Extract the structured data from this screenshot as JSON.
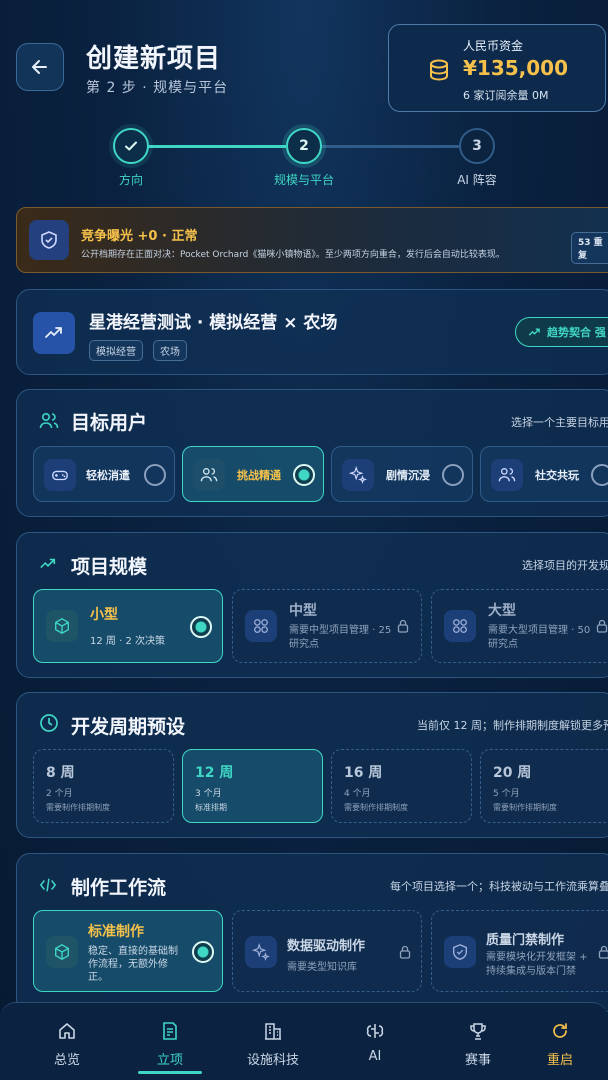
{
  "header": {
    "title": "创建新项目",
    "subtitle": "第 2 步 · 规模与平台"
  },
  "funds": {
    "label": "人民币资金",
    "value": "¥135,000",
    "note": "6 家订阅余量 0M"
  },
  "steps": [
    {
      "label": "方向",
      "state": "done"
    },
    {
      "label": "规模与平台",
      "number": "2",
      "state": "current"
    },
    {
      "label": "AI 阵容",
      "number": "3",
      "state": "pending"
    }
  ],
  "warning": {
    "title": "竞争曝光 +0 · 正常",
    "text": "公开档期存在正面对决：Pocket Orchard《猫咪小镇物语》。至少两项方向重合，发行后会自动比较表现。",
    "badge": "53 重复"
  },
  "project": {
    "name": "星港经营测试 · 模拟经营 × 农场",
    "tags": [
      "模拟经营",
      "农场"
    ],
    "trend": "趋势契合 强"
  },
  "audience": {
    "title": "目标用户",
    "hint": "选择一个主要目标用",
    "options": [
      {
        "label": "轻松消遣",
        "icon": "gamepad-icon",
        "selected": false
      },
      {
        "label": "挑战精通",
        "icon": "users-icon",
        "selected": true
      },
      {
        "label": "剧情沉浸",
        "icon": "sparkle-icon",
        "selected": false
      },
      {
        "label": "社交共玩",
        "icon": "users-icon",
        "selected": false
      }
    ]
  },
  "scale": {
    "title": "项目规模",
    "hint": "选择项目的开发规",
    "options": [
      {
        "name": "小型",
        "desc": "12 周 · 2 次决策",
        "selected": true,
        "locked": false
      },
      {
        "name": "中型",
        "desc": "需要中型项目管理 · 25 研究点",
        "selected": false,
        "locked": true
      },
      {
        "name": "大型",
        "desc": "需要大型项目管理 · 50 研究点",
        "selected": false,
        "locked": true
      }
    ]
  },
  "period": {
    "title": "开发周期预设",
    "hint": "当前仅 12 周；制作排期制度解锁更多预",
    "options": [
      {
        "weeks": "8 周",
        "months": "2 个月",
        "note": "需要制作排期制度",
        "selected": false
      },
      {
        "weeks": "12 周",
        "months": "3 个月",
        "note": "标准排期",
        "selected": true
      },
      {
        "weeks": "16 周",
        "months": "4 个月",
        "note": "需要制作排期制度",
        "selected": false
      },
      {
        "weeks": "20 周",
        "months": "5 个月",
        "note": "需要制作排期制度",
        "selected": false
      }
    ]
  },
  "workflow": {
    "title": "制作工作流",
    "hint": "每个项目选择一个；科技被动与工作流乘算叠",
    "options": [
      {
        "name": "标准制作",
        "desc": "稳定、直接的基础制作流程，无额外修正。",
        "selected": true,
        "locked": false
      },
      {
        "name": "数据驱动制作",
        "desc": "需要类型知识库",
        "selected": false,
        "locked": true
      },
      {
        "name": "质量门禁制作",
        "desc": "需要模块化开发框架 + 持续集成与版本门禁",
        "selected": false,
        "locked": true
      }
    ]
  },
  "nav": [
    {
      "label": "总览",
      "icon": "home-icon",
      "active": false
    },
    {
      "label": "立项",
      "icon": "project-icon",
      "active": true
    },
    {
      "label": "设施科技",
      "icon": "building-icon",
      "active": false
    },
    {
      "label": "AI",
      "icon": "ai-icon",
      "active": false
    },
    {
      "label": "赛事",
      "icon": "trophy-icon",
      "active": false
    },
    {
      "label": "重启",
      "icon": "restart-icon",
      "active": false
    }
  ],
  "colors": {
    "accent": "#3fd6c4",
    "gold": "#f5c14b",
    "background": "#071a33"
  }
}
